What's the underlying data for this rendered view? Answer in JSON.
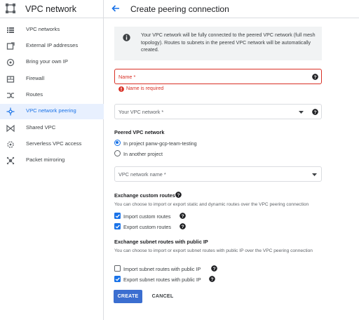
{
  "app": {
    "title": "VPC network"
  },
  "sidebar": {
    "items": [
      {
        "label": "VPC networks",
        "icon": "vpc-networks-icon",
        "active": false
      },
      {
        "label": "External IP addresses",
        "icon": "external-ip-icon",
        "active": false
      },
      {
        "label": "Bring your own IP",
        "icon": "byoip-icon",
        "active": false
      },
      {
        "label": "Firewall",
        "icon": "firewall-icon",
        "active": false
      },
      {
        "label": "Routes",
        "icon": "routes-icon",
        "active": false
      },
      {
        "label": "VPC network peering",
        "icon": "peering-icon",
        "active": true
      },
      {
        "label": "Shared VPC",
        "icon": "shared-vpc-icon",
        "active": false
      },
      {
        "label": "Serverless VPC access",
        "icon": "serverless-icon",
        "active": false
      },
      {
        "label": "Packet mirroring",
        "icon": "packet-mirroring-icon",
        "active": false
      }
    ]
  },
  "header": {
    "title": "Create peering connection",
    "back_icon": "arrow-back-icon"
  },
  "info": {
    "icon": "info-icon",
    "text": "Your VPC network will be fully connected to the peered VPC network (full mesh topology). Routes to subnets in the peered VPC network will be automatically created."
  },
  "form": {
    "name": {
      "label": "Name *",
      "error": "Name is required"
    },
    "your_network": {
      "label": "Your VPC network *"
    },
    "peered_section": {
      "title": "Peered VPC network",
      "options": [
        {
          "label": "In project panw-gcp-team-testing",
          "selected": true
        },
        {
          "label": "In another project",
          "selected": false
        }
      ]
    },
    "network_name": {
      "label": "VPC network name *"
    },
    "custom_routes": {
      "title": "Exchange custom routes",
      "description": "You can choose to import or export static and dynamic routes over the VPC peering connection",
      "import_label": "Import custom routes",
      "import_checked": true,
      "export_label": "Export custom routes",
      "export_checked": true
    },
    "subnet_routes": {
      "title": "Exchange subnet routes with public IP",
      "description": "You can choose to import or export subnet routes with public IP over the VPC peering connection",
      "import_label": "Import subnet routes with public IP",
      "import_checked": false,
      "export_label": "Export subnet routes with public IP",
      "export_checked": true
    }
  },
  "actions": {
    "create": "CREATE",
    "cancel": "CANCEL"
  },
  "colors": {
    "accent": "#1a73e8",
    "error": "#d93025",
    "button": "#3b6ed0",
    "active_bg": "#e8f0fe"
  }
}
